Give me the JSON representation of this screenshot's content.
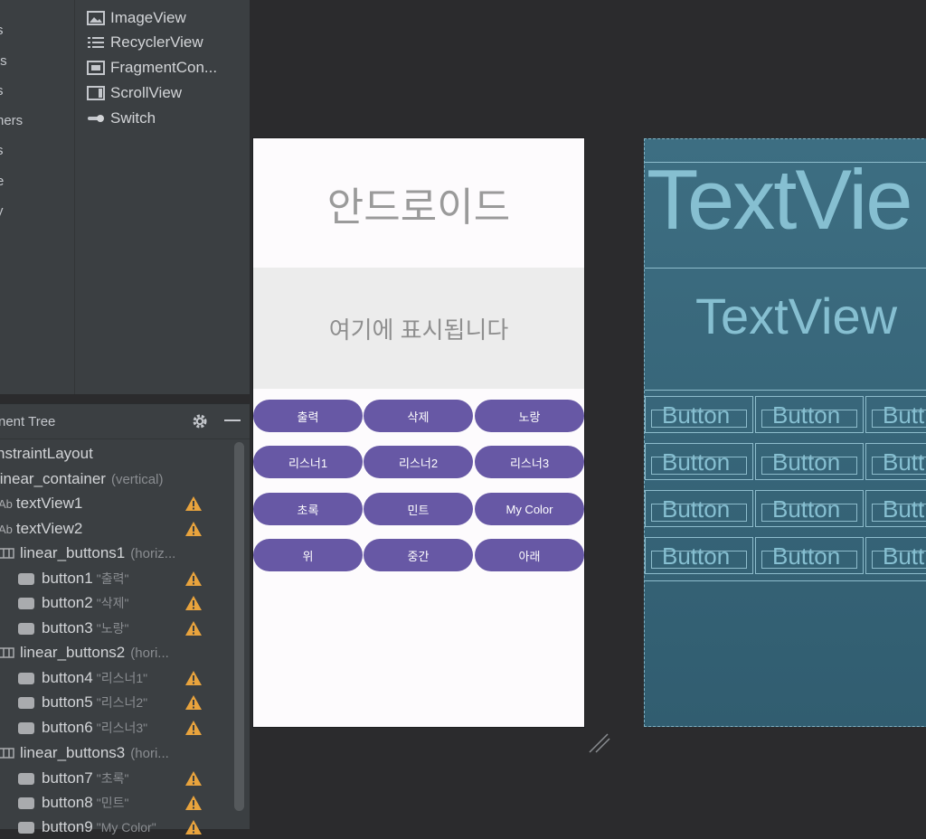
{
  "palette": {
    "categories": [
      "s",
      "ts",
      "s",
      "ners",
      "s",
      "e",
      "y"
    ],
    "widgets": [
      {
        "label": "ImageView",
        "icon": "image-icon"
      },
      {
        "label": "RecyclerView",
        "icon": "list-icon"
      },
      {
        "label": "FragmentCon...",
        "icon": "fragment-icon"
      },
      {
        "label": "ScrollView",
        "icon": "scrollview-icon"
      },
      {
        "label": "Switch",
        "icon": "switch-icon"
      }
    ]
  },
  "tree": {
    "title": "nent Tree",
    "rows": [
      {
        "label": "nstraintLayout",
        "note": "",
        "icon": "",
        "warn": false
      },
      {
        "label": "linear_container",
        "note": "(vertical)",
        "icon": "",
        "warn": false
      },
      {
        "label": "textView1",
        "note": "",
        "icon": "text-icon",
        "warn": true
      },
      {
        "label": "textView2",
        "note": "",
        "icon": "text-icon",
        "warn": true
      },
      {
        "label": "linear_buttons1",
        "note": "(horiz...",
        "icon": "linear-icon",
        "warn": false
      },
      {
        "label": "button1",
        "note": "\"출력\"",
        "icon": "button-icon",
        "warn": true
      },
      {
        "label": "button2",
        "note": "\"삭제\"",
        "icon": "button-icon",
        "warn": true
      },
      {
        "label": "button3",
        "note": "\"노랑\"",
        "icon": "button-icon",
        "warn": true
      },
      {
        "label": "linear_buttons2",
        "note": "(hori...",
        "icon": "linear-icon",
        "warn": false
      },
      {
        "label": "button4",
        "note": "\"리스너1\"",
        "icon": "button-icon",
        "warn": true
      },
      {
        "label": "button5",
        "note": "\"리스너2\"",
        "icon": "button-icon",
        "warn": true
      },
      {
        "label": "button6",
        "note": "\"리스너3\"",
        "icon": "button-icon",
        "warn": true
      },
      {
        "label": "linear_buttons3",
        "note": "(hori...",
        "icon": "linear-icon",
        "warn": false
      },
      {
        "label": "button7",
        "note": "\"초록\"",
        "icon": "button-icon",
        "warn": true
      },
      {
        "label": "button8",
        "note": "\"민트\"",
        "icon": "button-icon",
        "warn": true
      },
      {
        "label": "button9",
        "note": "\"My Color\"",
        "icon": "button-icon",
        "warn": true
      }
    ]
  },
  "phone": {
    "title": "안드로이드",
    "display": "여기에 표시됩니다",
    "buttons": [
      "출력",
      "삭제",
      "노랑",
      "리스너1",
      "리스너2",
      "리스너3",
      "초록",
      "민트",
      "My Color",
      "위",
      "중간",
      "아래"
    ],
    "button_color": "#6758a5"
  },
  "blueprint": {
    "text1": "TextVie",
    "text2": "TextView",
    "button_label": "Butt",
    "button_label_full": "Button"
  },
  "colors": {
    "warning": "#e8a33d",
    "blueprint_bg": "#3d6e82"
  }
}
